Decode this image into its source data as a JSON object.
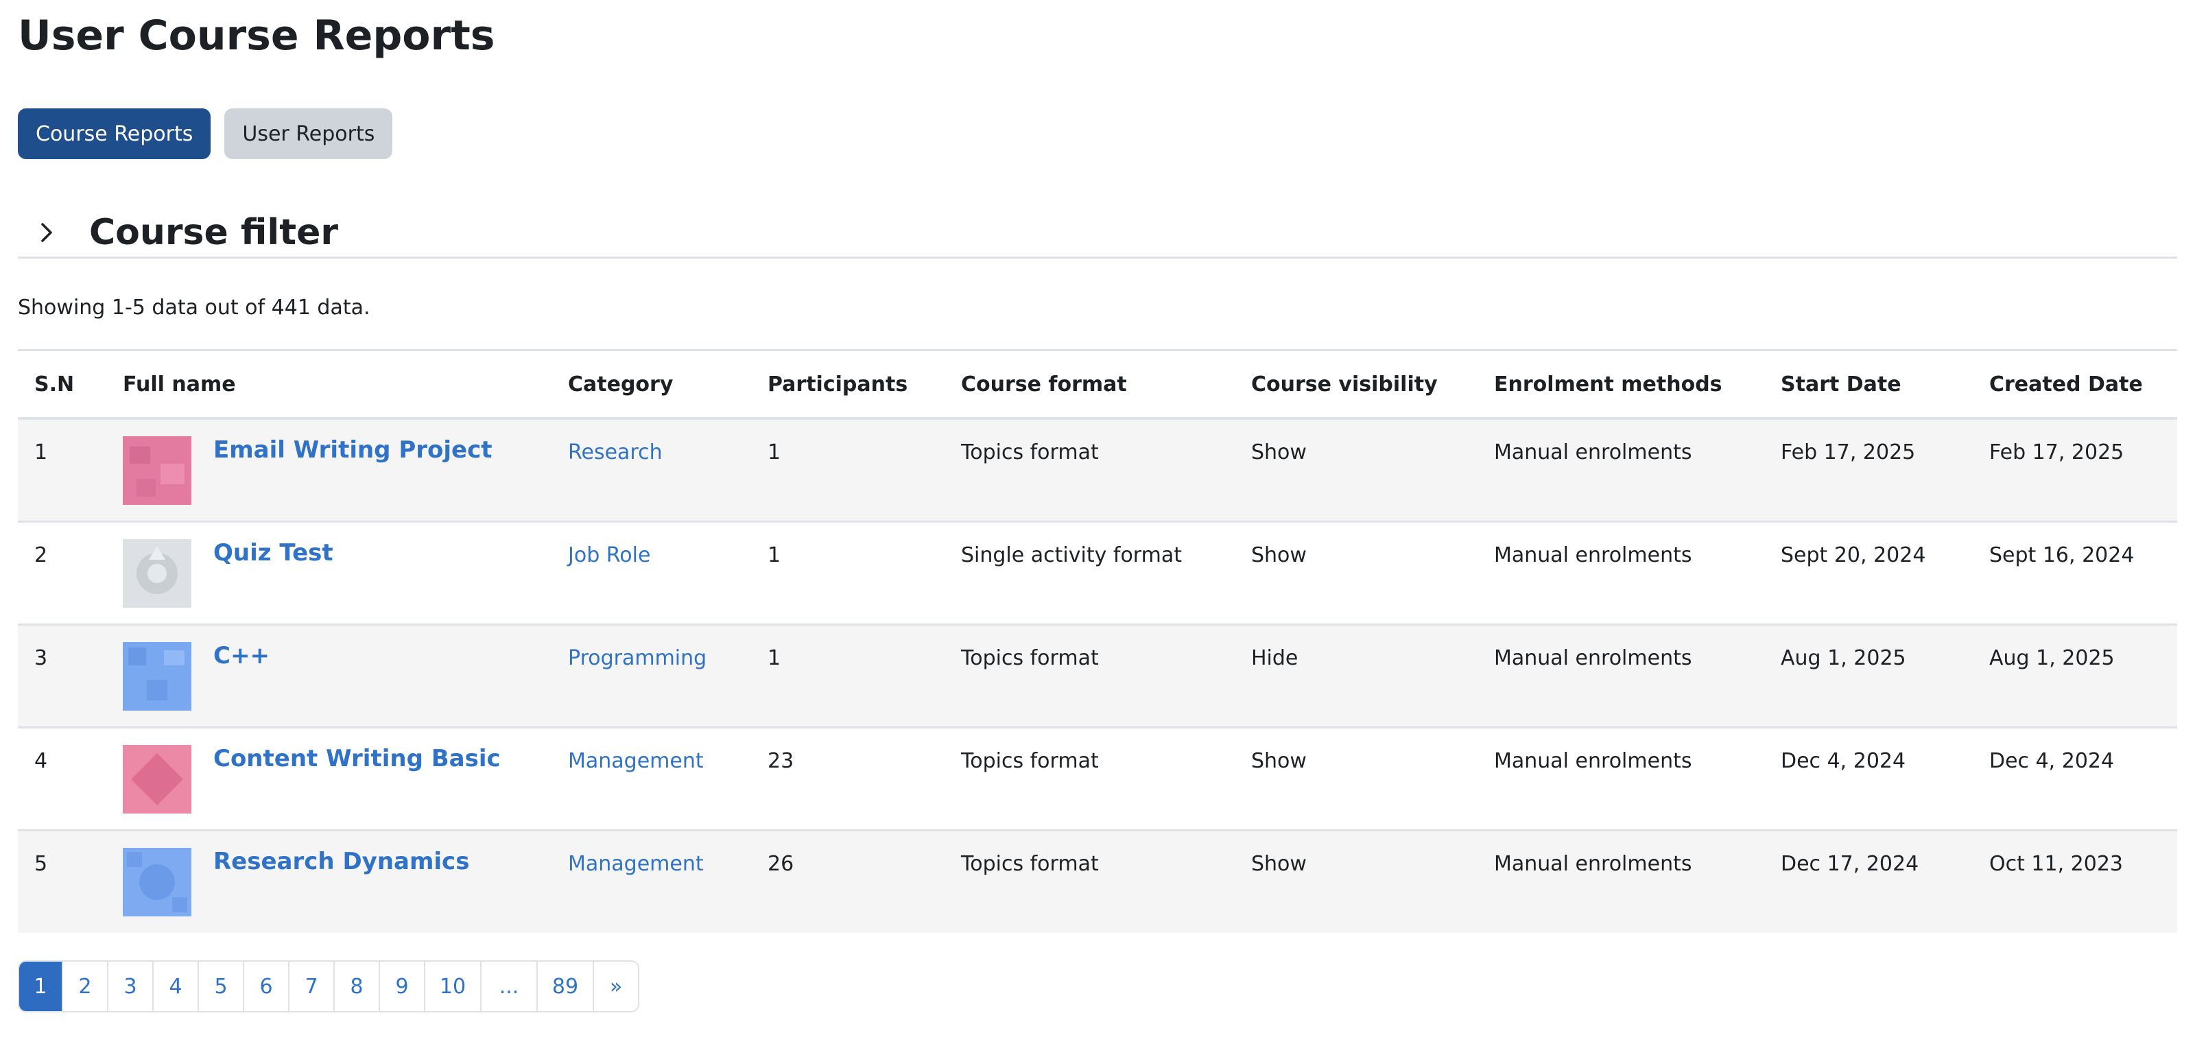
{
  "page": {
    "title": "User Course Reports"
  },
  "tabs": {
    "course_reports": "Course Reports",
    "user_reports": "User Reports"
  },
  "filter": {
    "title": "Course filter"
  },
  "summary": "Showing 1-5 data out of 441 data.",
  "table": {
    "headers": [
      "S.N",
      "Full name",
      "Category",
      "Participants",
      "Course format",
      "Course visibility",
      "Enrolment methods",
      "Start Date",
      "Created Date"
    ],
    "rows": [
      {
        "sn": "1",
        "name": "Email Writing Project",
        "category": "Research",
        "participants": "1",
        "format": "Topics format",
        "visibility": "Show",
        "enrolment": "Manual enrolments",
        "start": "Feb 17, 2025",
        "created": "Feb 17, 2025",
        "thumb_color": "#e37aa0"
      },
      {
        "sn": "2",
        "name": "Quiz Test",
        "category": "Job Role",
        "participants": "1",
        "format": "Single activity format",
        "visibility": "Show",
        "enrolment": "Manual enrolments",
        "start": "Sept 20, 2024",
        "created": "Sept 16, 2024",
        "thumb_color": "#dde1e5"
      },
      {
        "sn": "3",
        "name": "C++",
        "category": "Programming",
        "participants": "1",
        "format": "Topics format",
        "visibility": "Hide",
        "enrolment": "Manual enrolments",
        "start": "Aug 1, 2025",
        "created": "Aug 1, 2025",
        "thumb_color": "#7aa8f0"
      },
      {
        "sn": "4",
        "name": "Content Writing Basic",
        "category": "Management",
        "participants": "23",
        "format": "Topics format",
        "visibility": "Show",
        "enrolment": "Manual enrolments",
        "start": "Dec 4, 2024",
        "created": "Dec 4, 2024",
        "thumb_color": "#ec89a6"
      },
      {
        "sn": "5",
        "name": "Research Dynamics",
        "category": "Management",
        "participants": "26",
        "format": "Topics format",
        "visibility": "Show",
        "enrolment": "Manual enrolments",
        "start": "Dec 17, 2024",
        "created": "Oct 11, 2023",
        "thumb_color": "#7eaaf2"
      }
    ]
  },
  "pagination": {
    "pages": [
      "1",
      "2",
      "3",
      "4",
      "5",
      "6",
      "7",
      "8",
      "9",
      "10",
      "...",
      "89",
      "»"
    ],
    "current": "1"
  },
  "colors": {
    "primary": "#1f4e8c",
    "link": "#2f72c6",
    "active_page": "#2d6cc0",
    "secondary": "#ced4da"
  },
  "icons": {
    "filter_toggle": "chevron-right-icon"
  }
}
